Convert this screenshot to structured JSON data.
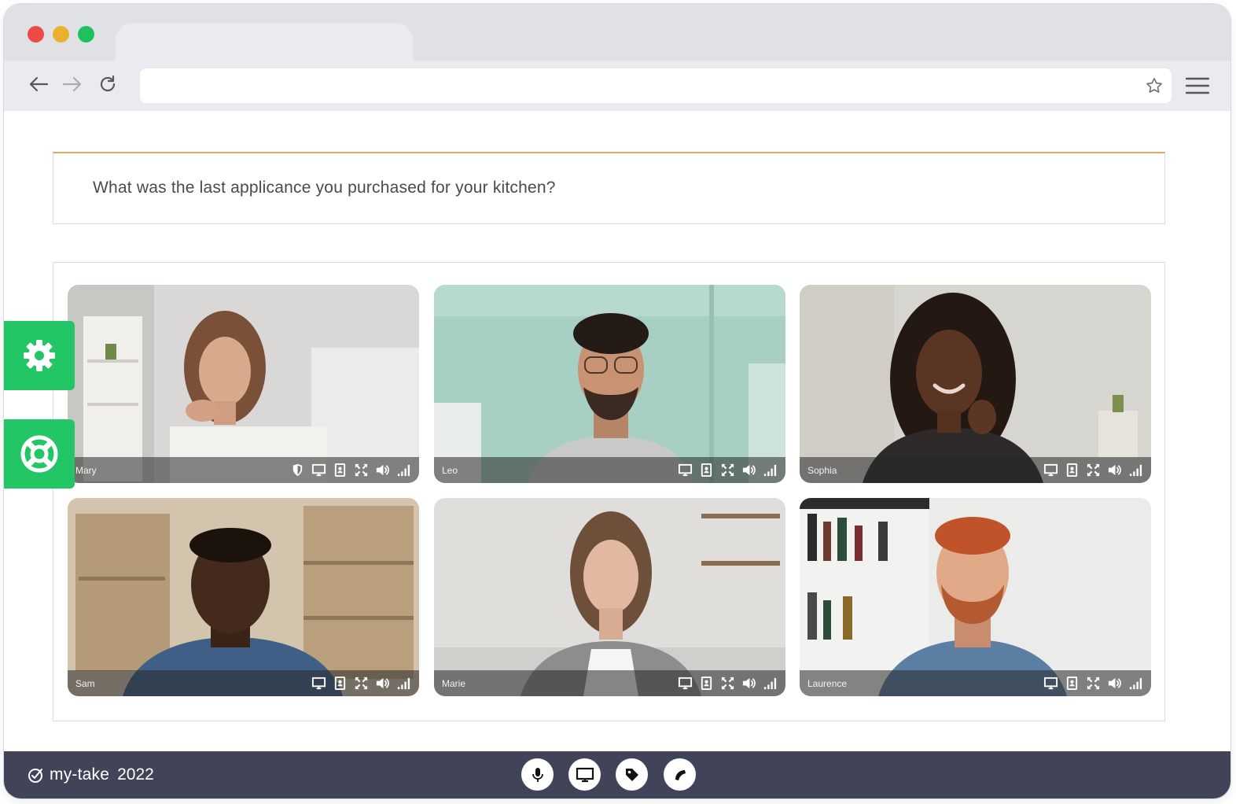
{
  "browser": {
    "address_value": "",
    "icons": {
      "back": "arrow-left-icon",
      "forward": "arrow-right-icon",
      "reload": "reload-icon",
      "bookmark": "star-icon",
      "menu": "hamburger-menu-icon"
    }
  },
  "question": {
    "text": "What was the last applicance you purchased for your kitchen?"
  },
  "side_buttons": [
    {
      "icon": "gear-icon"
    },
    {
      "icon": "lifebuoy-icon"
    }
  ],
  "participants": [
    {
      "name": "Mary",
      "icons": [
        "shield-icon",
        "screen-icon",
        "contact-icon",
        "expand-icon",
        "volume-icon",
        "signal-icon"
      ]
    },
    {
      "name": "Leo",
      "icons": [
        "screen-icon",
        "contact-icon",
        "expand-icon",
        "volume-icon",
        "signal-icon"
      ]
    },
    {
      "name": "Sophia",
      "icons": [
        "screen-icon",
        "contact-icon",
        "expand-icon",
        "volume-icon",
        "signal-icon"
      ]
    },
    {
      "name": "Sam",
      "icons": [
        "screen-icon",
        "contact-icon",
        "expand-icon",
        "volume-icon",
        "signal-icon"
      ]
    },
    {
      "name": "Marie",
      "icons": [
        "screen-icon",
        "contact-icon",
        "expand-icon",
        "volume-icon",
        "signal-icon"
      ]
    },
    {
      "name": "Laurence",
      "icons": [
        "screen-icon",
        "contact-icon",
        "expand-icon",
        "volume-icon",
        "signal-icon"
      ]
    }
  ],
  "footer": {
    "brand": "my-take",
    "year": "2022",
    "controls": [
      "microphone-icon",
      "screen-share-icon",
      "tag-icon",
      "end-call-icon"
    ]
  },
  "colors": {
    "accent_green": "#22c665",
    "footer_bg": "#414458",
    "question_border": "#f0a35e"
  }
}
